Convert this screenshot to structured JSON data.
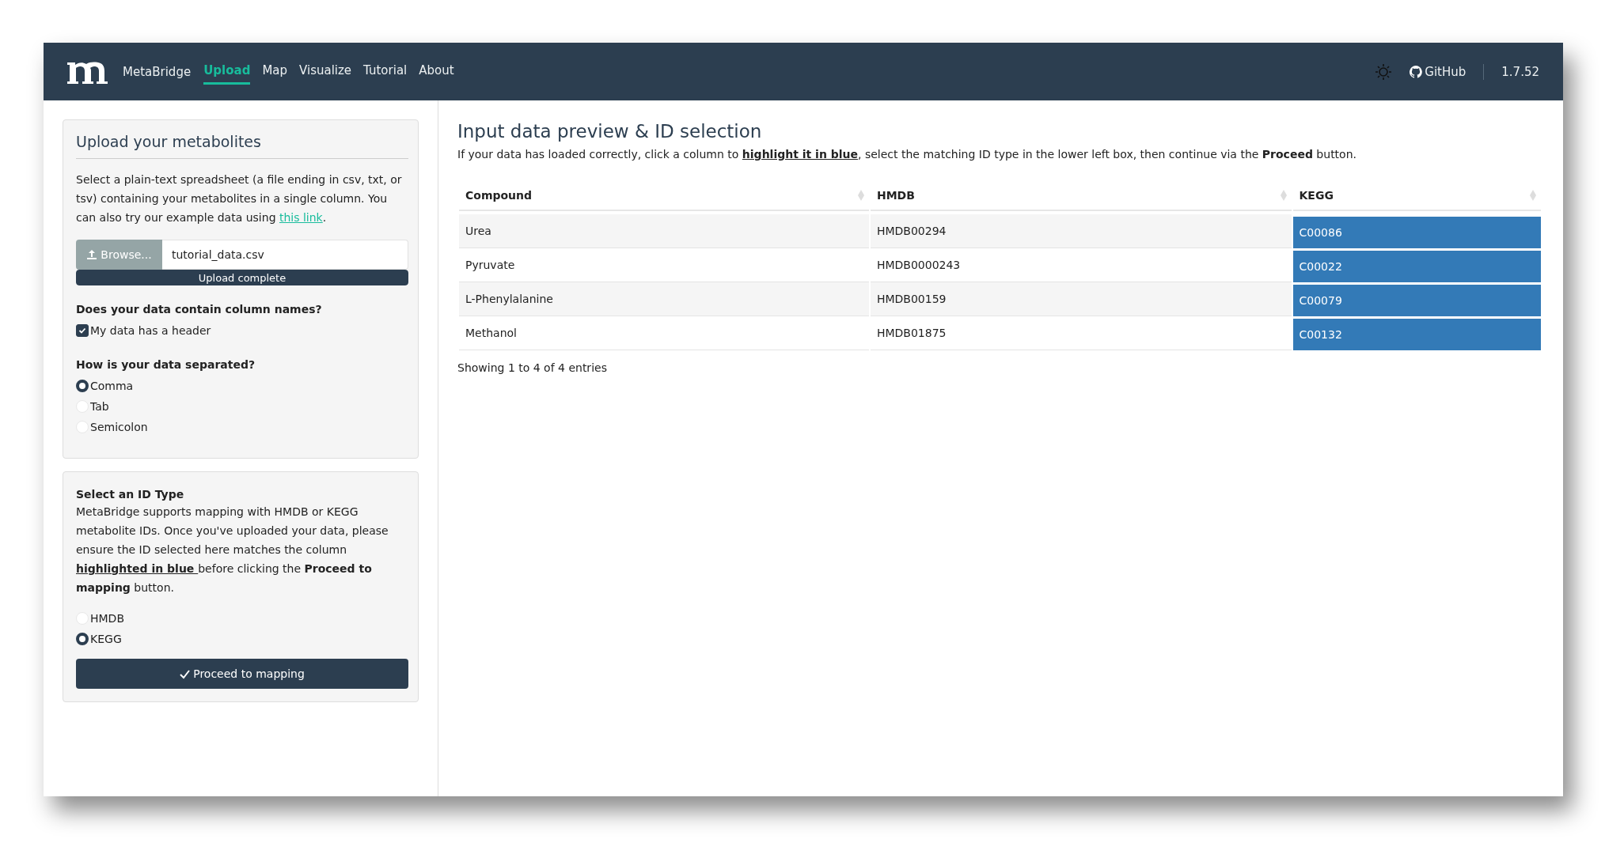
{
  "navbar": {
    "brand": "MetaBridge",
    "items": [
      {
        "label": "Upload",
        "selected": true
      },
      {
        "label": "Map",
        "selected": false
      },
      {
        "label": "Visualize",
        "selected": false
      },
      {
        "label": "Tutorial",
        "selected": false
      },
      {
        "label": "About",
        "selected": false
      }
    ],
    "github": "GitHub",
    "version": "1.7.52"
  },
  "upload_card": {
    "title": "Upload your metabolites",
    "description": [
      {
        "kind": "plain",
        "text": "Select a plain-text spreadsheet (a file ending in csv, txt, or tsv) containing your metabolites in a single column. You can also try our example data using "
      },
      {
        "kind": "link",
        "text": "this link"
      },
      {
        "kind": "plain",
        "text": "."
      }
    ],
    "browse_button": "Browse...",
    "file_name": "tutorial_data.csv",
    "progress": {
      "label": "Upload complete",
      "level": 1
    },
    "header_question": "Does your data contain column names?",
    "header_checkbox": {
      "label": "My data has a header",
      "checked": true
    },
    "separator_question": "How is your data separated?",
    "separators": [
      {
        "label": "Comma",
        "selected": true
      },
      {
        "label": "Tab",
        "selected": false
      },
      {
        "label": "Semicolon",
        "selected": false
      }
    ]
  },
  "id_card": {
    "title": "Select an ID Type",
    "description": [
      {
        "kind": "plain",
        "text": "MetaBridge supports mapping with HMDB or KEGG metabolite IDs. Once you've uploaded your data, please ensure the ID selected here matches the column "
      },
      {
        "kind": "emph",
        "text": "highlighted in blue "
      },
      {
        "kind": "plain",
        "text": "before clicking the "
      },
      {
        "kind": "bold",
        "text": "Proceed to mapping"
      },
      {
        "kind": "plain",
        "text": " button."
      }
    ],
    "options": [
      {
        "label": "HMDB",
        "selected": false
      },
      {
        "label": "KEGG",
        "selected": true
      }
    ],
    "proceed_button": "Proceed to mapping"
  },
  "preview": {
    "title": "Input data preview & ID selection",
    "instructions": [
      {
        "kind": "plain",
        "text": "If your data has loaded correctly, click a column to "
      },
      {
        "kind": "emph",
        "text": "highlight it in blue"
      },
      {
        "kind": "plain",
        "text": ", select the matching ID type in the lower left box, then continue via the "
      },
      {
        "kind": "bold",
        "text": "Proceed"
      },
      {
        "kind": "plain",
        "text": " button."
      }
    ],
    "table": {
      "columns": [
        {
          "label": "Compound",
          "selected": false
        },
        {
          "label": "HMDB",
          "selected": false
        },
        {
          "label": "KEGG",
          "selected": true
        }
      ],
      "rows": [
        [
          "Urea",
          "HMDB00294",
          "C00086"
        ],
        [
          "Pyruvate",
          "HMDB0000243",
          "C00022"
        ],
        [
          "L-Phenylalanine",
          "HMDB00159",
          "C00079"
        ],
        [
          "Methanol",
          "HMDB01875",
          "C00132"
        ]
      ]
    },
    "footer": "Showing 1 to 4 of 4 entries"
  }
}
